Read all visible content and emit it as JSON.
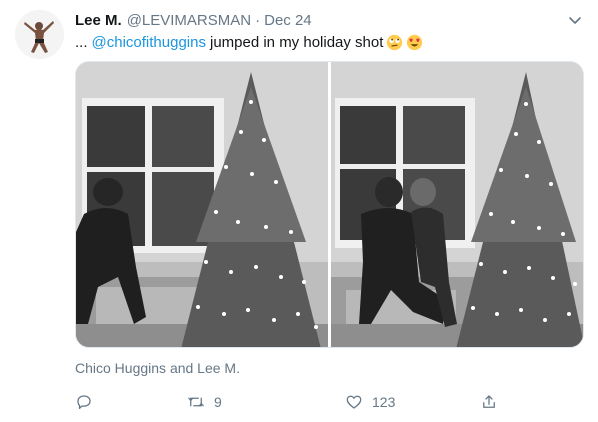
{
  "tweet": {
    "author_name": "Lee M.",
    "author_handle": "@LEVIMARSMAN",
    "separator": "·",
    "date": "Dec 24",
    "text_prefix": "...",
    "mention": "@chicofithuggins",
    "text_body": "jumped in my holiday shot",
    "emojis": [
      "face-with-rolling-eyes",
      "smiling-face-with-heart-eyes"
    ],
    "tagged_people": "Chico Huggins and Lee M.",
    "replies_count": "",
    "retweets_count": "9",
    "likes_count": "123"
  },
  "icons": {
    "caret": "chevron-down-icon",
    "reply": "comment-icon",
    "retweet": "retweet-icon",
    "like": "heart-icon",
    "share": "share-icon"
  },
  "colors": {
    "link": "#1b95e0",
    "secondary_text": "#657786",
    "primary_text": "#14171a",
    "border": "#e1e8ed"
  }
}
